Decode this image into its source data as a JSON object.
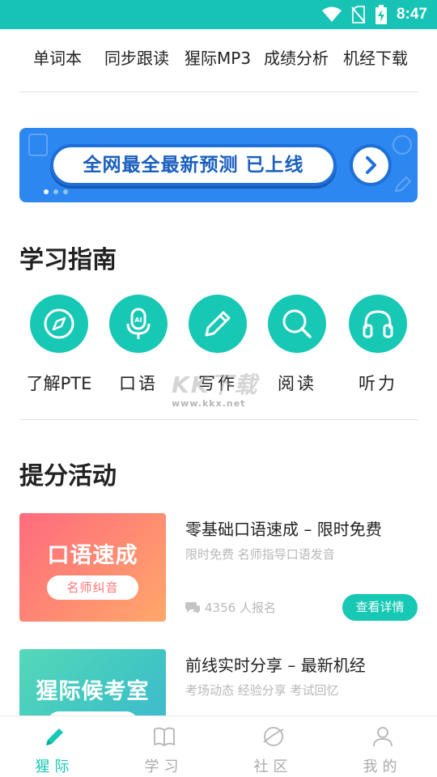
{
  "status_bar": {
    "time": "8:47",
    "icons": [
      "wifi-icon",
      "no-sim-icon",
      "battery-charging-icon"
    ]
  },
  "top_nav": {
    "items": [
      "单词本",
      "同步跟读",
      "猩际MP3",
      "成绩分析",
      "机经下载"
    ]
  },
  "banner": {
    "text": "全网最全最新预测 已上线",
    "colors": {
      "background": "#2c87f1",
      "pill_text": "#1a5fbf"
    }
  },
  "study_guide": {
    "title": "学习指南",
    "items": [
      {
        "label": "了解PTE",
        "icon": "compass-icon"
      },
      {
        "label": "口语",
        "icon": "microphone-ai-icon"
      },
      {
        "label": "写作",
        "icon": "pencil-icon"
      },
      {
        "label": "阅读",
        "icon": "search-icon"
      },
      {
        "label": "听力",
        "icon": "headphones-icon"
      }
    ]
  },
  "watermark": {
    "logo_text": "KK下载",
    "url": "www.kkx.net"
  },
  "activities": {
    "title": "提分活动",
    "items": [
      {
        "thumb_title": "口语速成",
        "thumb_tag": "名师纠音",
        "title": "零基础口语速成 – 限时免费",
        "subtitle": "限时免费  名师指导口语发音",
        "count": "4356 人报名",
        "button": "查看详情"
      },
      {
        "thumb_title": "猩际候考室",
        "title": "前线实时分享 – 最新机经",
        "subtitle": "考场动态  经验分享  考试回忆"
      }
    ]
  },
  "tab_bar": {
    "tabs": [
      {
        "label": "猩际",
        "icon": "pencil-icon",
        "active": true
      },
      {
        "label": "学习",
        "icon": "book-icon",
        "active": false
      },
      {
        "label": "社区",
        "icon": "planet-icon",
        "active": false
      },
      {
        "label": "我的",
        "icon": "person-icon",
        "active": false
      }
    ]
  },
  "colors": {
    "accent": "#17c8b5",
    "status_bar": "#16c3b4",
    "muted_text": "#b8b8b8"
  }
}
